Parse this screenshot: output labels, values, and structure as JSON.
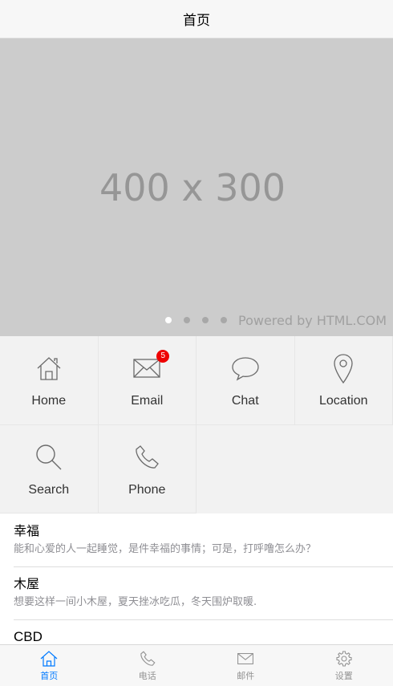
{
  "header": {
    "title": "首页"
  },
  "banner": {
    "placeholder_text": "400 x 300",
    "powered_text": "Powered by HTML.COM",
    "slide_count": 4,
    "active_slide": 1
  },
  "grid": {
    "items": [
      {
        "label": "Home",
        "icon": "home-icon"
      },
      {
        "label": "Email",
        "icon": "email-icon",
        "badge": "5"
      },
      {
        "label": "Chat",
        "icon": "chat-icon"
      },
      {
        "label": "Location",
        "icon": "location-icon"
      },
      {
        "label": "Search",
        "icon": "search-icon"
      },
      {
        "label": "Phone",
        "icon": "phone-icon"
      }
    ]
  },
  "list": {
    "items": [
      {
        "title": "幸福",
        "desc": "能和心爱的人一起睡觉，是件幸福的事情；可是，打呼噜怎么办？"
      },
      {
        "title": "木屋",
        "desc": "想要这样一间小木屋，夏天挫冰吃瓜，冬天围炉取暖."
      },
      {
        "title": "CBD",
        "desc": ""
      }
    ]
  },
  "tabbar": {
    "items": [
      {
        "label": "首页",
        "icon": "home-icon",
        "active": true
      },
      {
        "label": "电话",
        "icon": "phone-icon"
      },
      {
        "label": "邮件",
        "icon": "email-icon"
      },
      {
        "label": "设置",
        "icon": "gear-icon"
      }
    ],
    "active_color": "#007aff",
    "inactive_color": "#929292"
  }
}
